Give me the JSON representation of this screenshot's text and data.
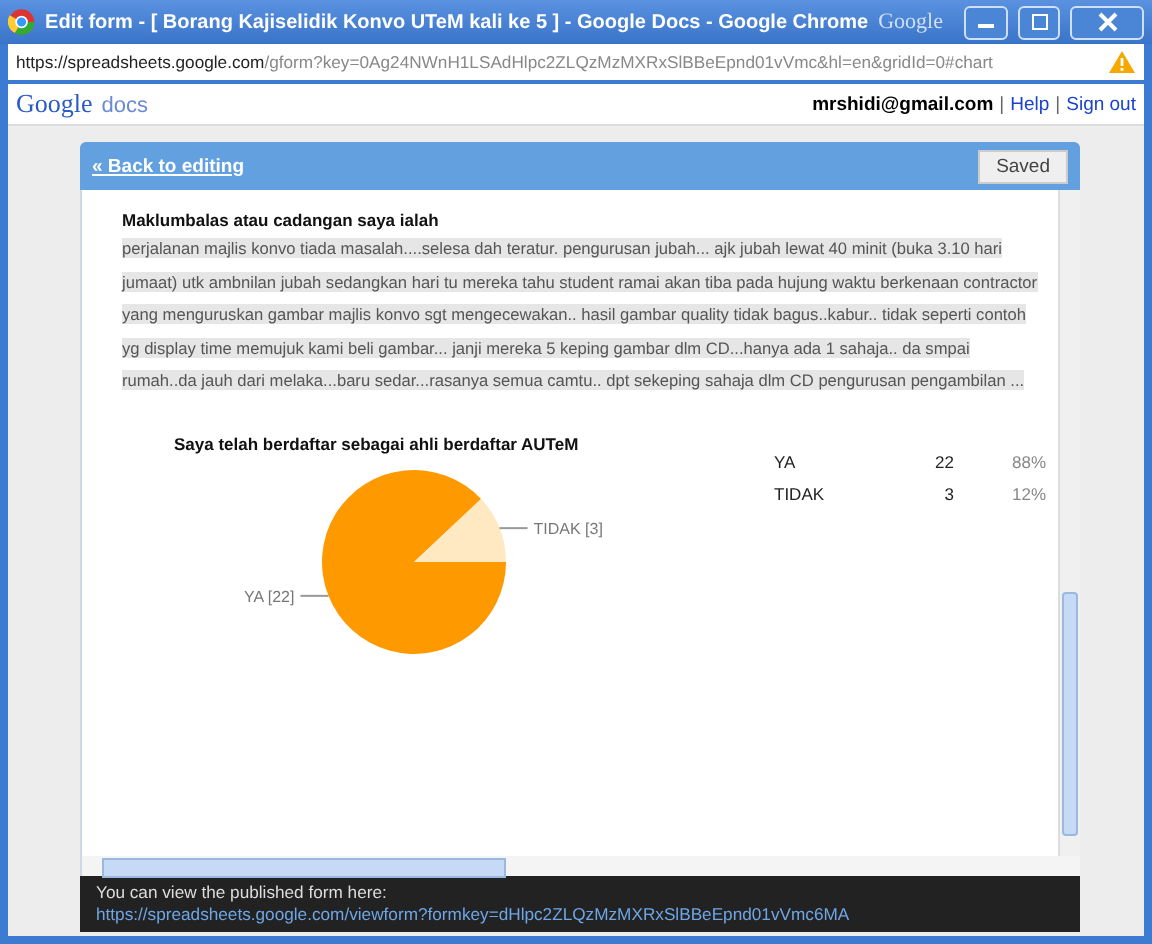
{
  "window": {
    "title": "Edit form - [ Borang Kajiselidik Konvo UTeM kali ke 5 ] - Google Docs - Google Chrome",
    "brand": "Google"
  },
  "address_bar": {
    "host": "https://spreadsheets.google.com",
    "path": "/gform?key=0Ag24NWnH1LSAdHlpc2ZLQzMzMXRxSlBBeEpnd01vVmc&hl=en&gridId=0#chart"
  },
  "header": {
    "logo_main": "Google",
    "logo_sub": "docs",
    "email": "mrshidi@gmail.com",
    "separator": "|",
    "links": [
      "Help",
      "Sign out"
    ]
  },
  "toolbar": {
    "back_link": "« Back to editing",
    "saved_button": "Saved"
  },
  "comments": {
    "title": "Maklumbalas atau cadangan saya ialah",
    "text": " perjalanan majlis konvo tiada masalah....selesa dah teratur.  pengurusan jubah... ajk jubah lewat 40 minit (buka 3.10 hari jumaat) utk ambnilan jubah sedangkan hari tu mereka tahu student ramai akan tiba pada hujung waktu berkenaan contractor yang menguruskan gambar majlis konvo sgt mengecewakan.. hasil gambar quality tidak bagus..kabur.. tidak seperti contoh yg display time memujuk kami beli gambar...  janji mereka 5 keping gambar dlm CD...hanya ada 1 sahaja.. da smpai rumah..da jauh dari melaka...baru sedar...rasanya semua camtu.. dpt sekeping sahaja dlm CD  pengurusan pengambilan ",
    "more": "..."
  },
  "question": {
    "chart_data": {
      "type": "pie",
      "title": "Saya telah berdaftar sebagai ahli berdaftar AUTeM",
      "categories": [
        "YA [22]",
        "TIDAK [3]"
      ],
      "values": [
        22,
        3
      ]
    },
    "summary": [
      {
        "label": "YA",
        "count": "22",
        "percent": "88%"
      },
      {
        "label": "TIDAK",
        "count": "3",
        "percent": "12%"
      }
    ]
  },
  "notice": {
    "text": "You can view the published form here:",
    "link": "https://spreadsheets.google.com/viewform?formkey=dHlpc2ZLQzMzMXRxSlBBeEpnd01vVmc6MA"
  }
}
